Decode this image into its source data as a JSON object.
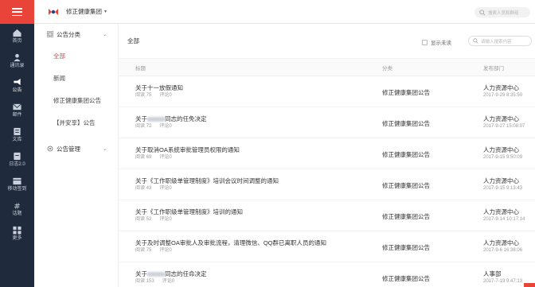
{
  "rail": {
    "items": [
      {
        "label": "首页",
        "icon": "home-icon"
      },
      {
        "label": "通讯录",
        "icon": "contacts-icon"
      },
      {
        "label": "公告",
        "icon": "announcement-icon"
      },
      {
        "label": "邮件",
        "icon": "mail-icon"
      },
      {
        "label": "文库",
        "icon": "library-icon"
      },
      {
        "label": "日志2.0",
        "icon": "log-icon"
      },
      {
        "label": "移动签到",
        "icon": "checkin-icon"
      },
      {
        "label": "话题",
        "icon": "topic-icon"
      },
      {
        "label": "更多",
        "icon": "more-icon"
      }
    ]
  },
  "topbar": {
    "org_name": "修正健康集团",
    "search_placeholder": "搜索人员和群组"
  },
  "categories": {
    "header": "公告分类",
    "items": [
      "全部",
      "新闻",
      "修正健康集团公告",
      "【并安享】公告"
    ],
    "management": "公告管理"
  },
  "toolbar": {
    "title": "全部",
    "unread_label": "显示未读",
    "search_placeholder": "请输入搜索内容"
  },
  "table": {
    "headers": [
      "标题",
      "分类",
      "发布部门"
    ],
    "rows": [
      {
        "title": "关于十一放假通知",
        "blurred": false,
        "title_suffix": "",
        "views": "阅读 75",
        "comments": "评论0",
        "category": "修正健康集团公告",
        "dept": "人力资源中心",
        "time": "2017-9-29 8:35:50"
      },
      {
        "title": "关于",
        "blurred": true,
        "title_suffix": "同志的任免决定",
        "views": "阅读 72",
        "comments": "评论0",
        "category": "修正健康集团公告",
        "dept": "人力资源中心",
        "time": "2017-9-27 15:08:07"
      },
      {
        "title": "关于取消OA系统审批管理员权限的通知",
        "blurred": false,
        "title_suffix": "",
        "views": "阅读 69",
        "comments": "评论0",
        "category": "修正健康集团公告",
        "dept": "人力资源中心",
        "time": "2017-9-15 9:50:09"
      },
      {
        "title": "关于《工作职级单管理制度》培训会议时间调整的通知",
        "blurred": false,
        "title_suffix": "",
        "views": "阅读 43",
        "comments": "评论0",
        "category": "修正健康集团公告",
        "dept": "人力资源中心",
        "time": "2017-9-15 9:13:43"
      },
      {
        "title": "关于《工作职级单管理制度》培训的通知",
        "blurred": false,
        "title_suffix": "",
        "views": "阅读 52",
        "comments": "评论0",
        "category": "修正健康集团公告",
        "dept": "人力资源中心",
        "time": "2017-9-14 10:17:14"
      },
      {
        "title": "关于及时调整OA审批人及审批流程，清理微信、QQ群已离职人员的通知",
        "blurred": false,
        "title_suffix": "",
        "views": "阅读 75",
        "comments": "评论0",
        "category": "修正健康集团公告",
        "dept": "人力资源中心",
        "time": "2017-9-6 16:38:06"
      },
      {
        "title": "关于",
        "blurred": true,
        "title_suffix": "同志的任命决定",
        "views": "阅读 153",
        "comments": "评论0",
        "category": "修正健康集团公告",
        "dept": "人事部",
        "time": "2017-7-19 9:47:13"
      }
    ]
  },
  "colors": {
    "accent": "#e8443a",
    "rail_bg": "#1f2a3c"
  }
}
